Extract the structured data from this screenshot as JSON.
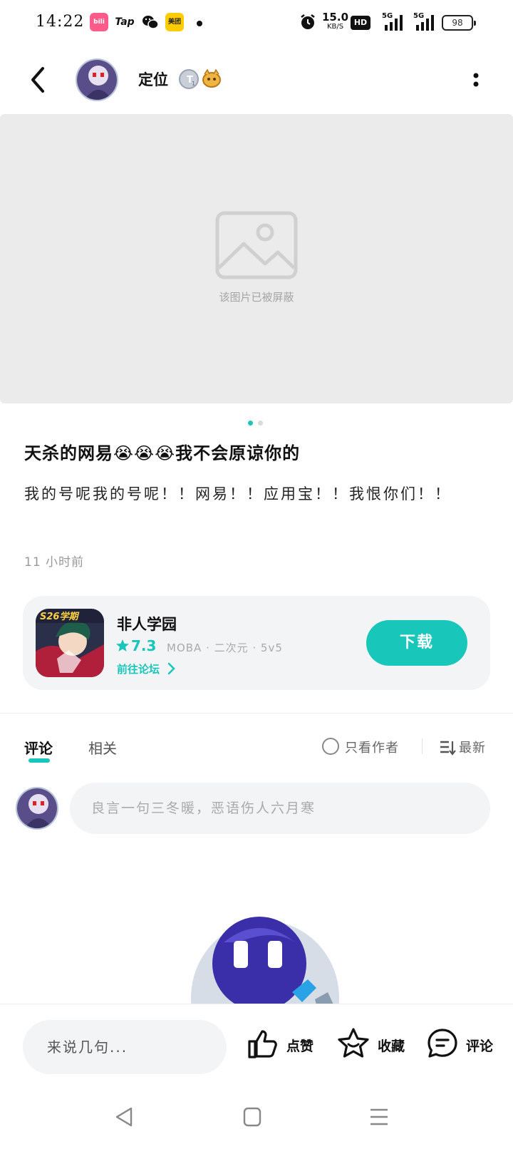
{
  "status_bar": {
    "time": "14:22",
    "apps": {
      "bili": "bilibili",
      "tap": "Tap",
      "meituan": "美团"
    },
    "net_speed": "15.0",
    "net_speed_unit": "KB/S",
    "hd": "HD",
    "network1": "5G",
    "network2": "5G",
    "battery": "98"
  },
  "header": {
    "username": "定位",
    "badge": "T1"
  },
  "gallery": {
    "blocked_text": "该图片已被屏蔽",
    "page_count": 2,
    "active_page": 1
  },
  "post": {
    "title": "天杀的网易😭😭😭我不会原谅你的",
    "body": "我的号呢我的号呢！！网易！！应用宝！！我恨你们！！",
    "time": "11 小时前"
  },
  "game_card": {
    "icon_label": "S26学期",
    "name": "非人学园",
    "rating": "7.3",
    "tags": "MOBA · 二次元 · 5v5",
    "forum_link": "前往论坛",
    "download_label": "下载"
  },
  "comments_section": {
    "tabs": [
      {
        "label": "评论",
        "active": true
      },
      {
        "label": "相关",
        "active": false
      }
    ],
    "author_only_label": "只看作者",
    "sort_label": "最新",
    "input_placeholder": "良言一句三冬暖，恶语伤人六月寒"
  },
  "bottom_bar": {
    "input_placeholder": "来说几句...",
    "like_label": "点赞",
    "favorite_label": "收藏",
    "comment_label": "评论"
  },
  "colors": {
    "accent": "#19c6ba",
    "card_bg": "#f2f4f6",
    "image_bg": "#ebebeb"
  }
}
